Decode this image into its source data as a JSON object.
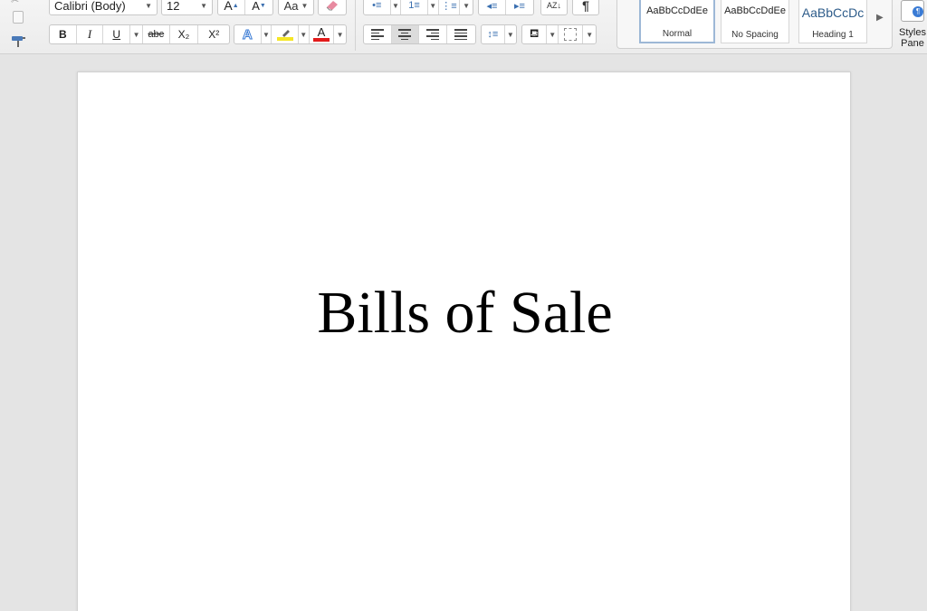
{
  "ribbon": {
    "font": {
      "family": "Calibri (Body)",
      "size": "12"
    },
    "format": {
      "bold": "B",
      "italic": "I",
      "underline": "U",
      "strikethrough": "abc",
      "subscript": "X₂",
      "superscript": "X²"
    },
    "font_color_letter": "A",
    "text_effects_letter": "A",
    "change_case": "Aa",
    "grow": "A",
    "shrink": "A",
    "styles": [
      {
        "preview": "AaBbCcDdEe",
        "name": "Normal"
      },
      {
        "preview": "AaBbCcDdEe",
        "name": "No Spacing"
      },
      {
        "preview": "AaBbCcDc",
        "name": "Heading 1"
      }
    ],
    "styles_pane_label": "Styles Pane",
    "colors": {
      "highlight": "#f5e625",
      "font_color": "#e21b1b",
      "heading_blue": "#2e5c8a"
    }
  },
  "document": {
    "title": "Bills of Sale"
  }
}
